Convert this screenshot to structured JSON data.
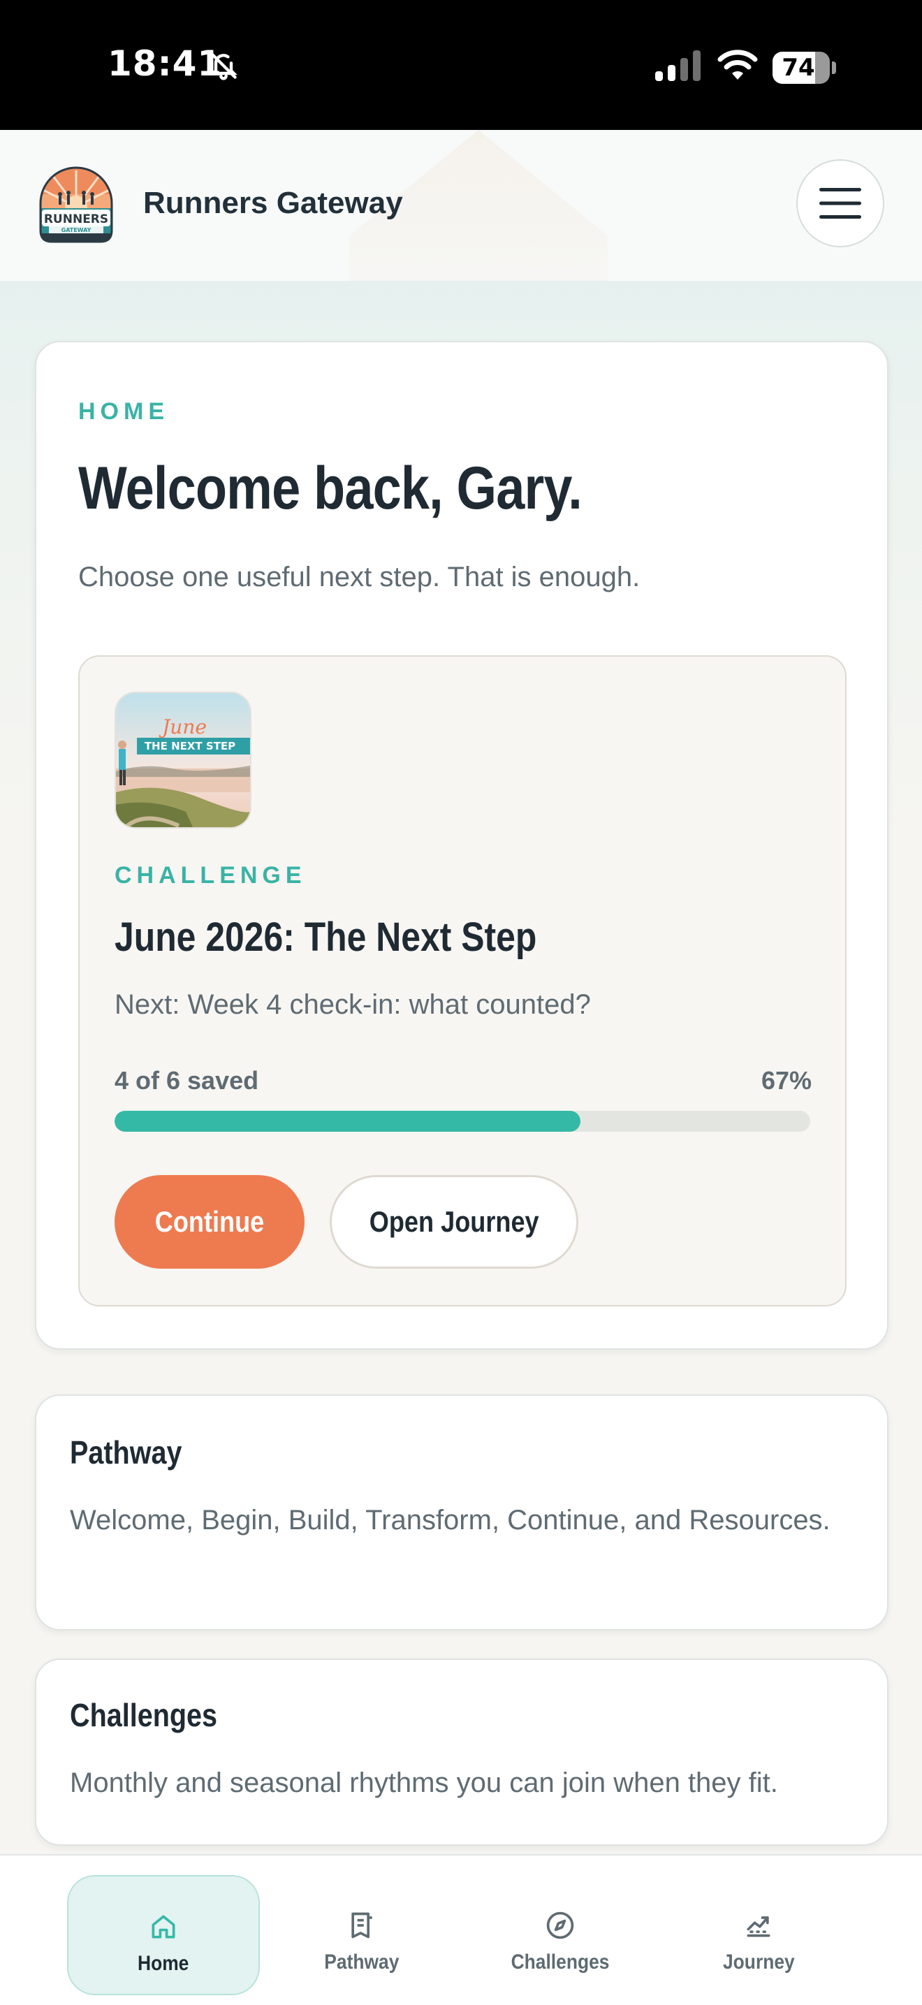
{
  "status_bar": {
    "time": "18:41",
    "battery": "74",
    "battery_level": 0.74,
    "icons": [
      "bell-off-icon",
      "cellular-signal-icon",
      "wifi-icon",
      "battery-icon"
    ]
  },
  "header": {
    "brand": "Runners Gateway",
    "logo_text": "RUNNERS",
    "logo_subtext": "GATEWAY",
    "menu_icon": "hamburger-icon"
  },
  "home": {
    "eyebrow": "HOME",
    "title": "Welcome back, Gary.",
    "tagline": "Choose one useful next step. That is enough."
  },
  "challenge": {
    "thumb_script": "June",
    "thumb_banner": "THE NEXT STEP",
    "eyebrow": "CHALLENGE",
    "title": "June 2026: The Next Step",
    "next": "Next: Week 4 check-in: what counted?",
    "progress_label": "4 of 6 saved",
    "progress_percent": "67%",
    "progress_value": 0.67,
    "continue_label": "Continue",
    "journey_label": "Open Journey"
  },
  "cards": {
    "pathway": {
      "title": "Pathway",
      "description": "Welcome, Begin, Build, Transform, Continue, and Resources."
    },
    "challenges": {
      "title": "Challenges",
      "description": "Monthly and seasonal rhythms you can join when they fit."
    }
  },
  "nav": [
    {
      "label": "Home",
      "icon": "home-icon",
      "active": true
    },
    {
      "label": "Pathway",
      "icon": "book-icon",
      "active": false
    },
    {
      "label": "Challenges",
      "icon": "compass-icon",
      "active": false
    },
    {
      "label": "Journey",
      "icon": "chart-icon",
      "active": false
    }
  ],
  "colors": {
    "accent_teal": "#35b9a7",
    "accent_orange": "#ee7a50",
    "text_dark": "#1f2a33",
    "text_muted": "#5f6b72"
  }
}
